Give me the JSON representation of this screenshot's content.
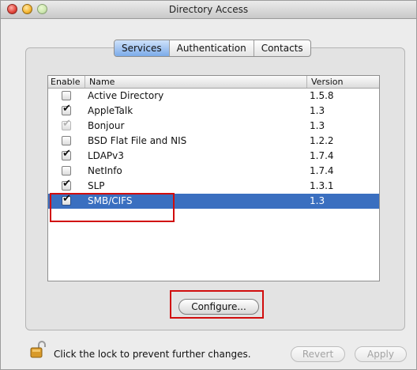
{
  "window": {
    "title": "Directory Access"
  },
  "tabs": [
    {
      "label": "Services",
      "active": true
    },
    {
      "label": "Authentication",
      "active": false
    },
    {
      "label": "Contacts",
      "active": false
    }
  ],
  "table": {
    "headers": {
      "enable": "Enable",
      "name": "Name",
      "version": "Version"
    },
    "rows": [
      {
        "name": "Active Directory",
        "version": "1.5.8",
        "enabled": false,
        "dim": false
      },
      {
        "name": "AppleTalk",
        "version": "1.3",
        "enabled": true,
        "dim": false
      },
      {
        "name": "Bonjour",
        "version": "1.3",
        "enabled": true,
        "dim": true
      },
      {
        "name": "BSD Flat File and NIS",
        "version": "1.2.2",
        "enabled": false,
        "dim": false
      },
      {
        "name": "LDAPv3",
        "version": "1.7.4",
        "enabled": true,
        "dim": false
      },
      {
        "name": "NetInfo",
        "version": "1.7.4",
        "enabled": false,
        "dim": false
      },
      {
        "name": "SLP",
        "version": "1.3.1",
        "enabled": true,
        "dim": false
      },
      {
        "name": "SMB/CIFS",
        "version": "1.3",
        "enabled": true,
        "dim": false,
        "selected": true
      }
    ]
  },
  "buttons": {
    "configure": "Configure...",
    "revert": "Revert",
    "apply": "Apply"
  },
  "footer": {
    "lock_text": "Click the lock to prevent further changes."
  },
  "colors": {
    "selection": "#3a6fc0",
    "highlight": "#d10d0d",
    "tab_active": "#7cabe9"
  }
}
